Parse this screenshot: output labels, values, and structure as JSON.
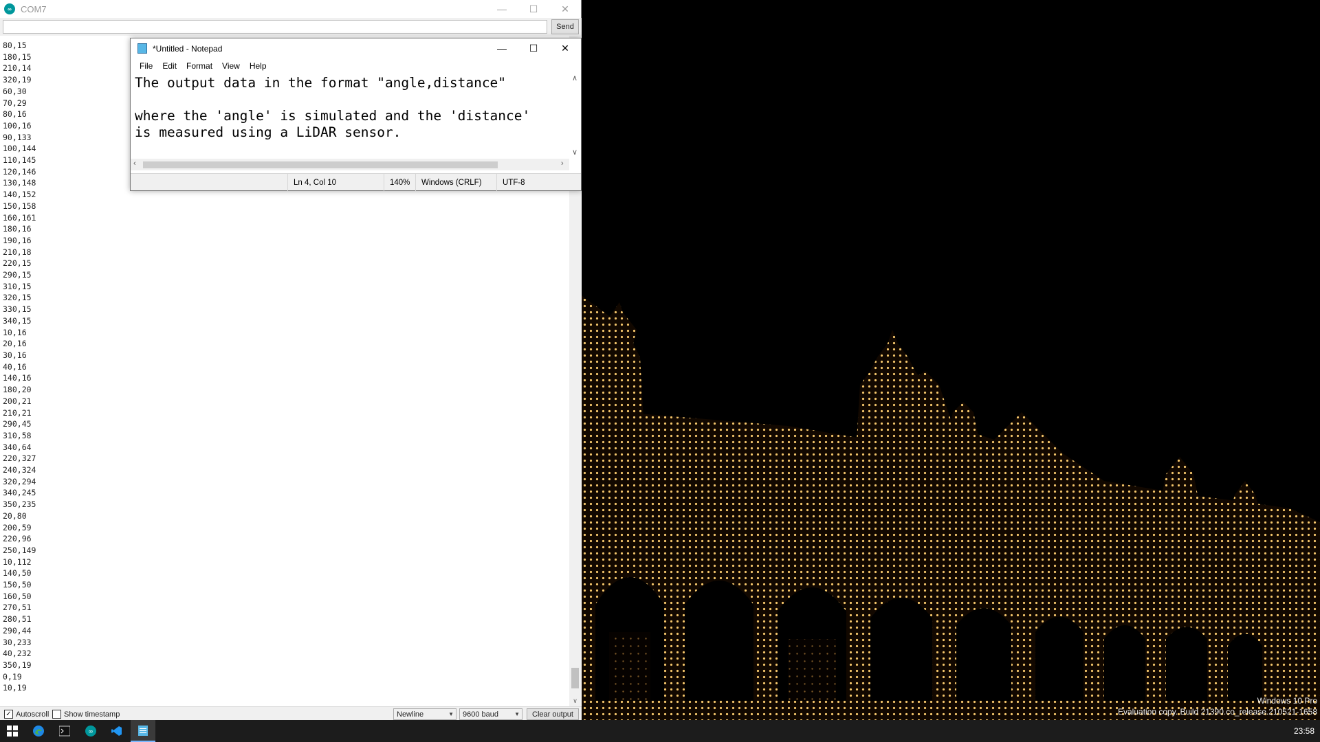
{
  "serial_monitor": {
    "title": "COM7",
    "send_label": "Send",
    "input_value": "",
    "output_lines": [
      "80,15",
      "180,15",
      "210,14",
      "320,19",
      "60,30",
      "70,29",
      "80,16",
      "100,16",
      "90,133",
      "100,144",
      "110,145",
      "120,146",
      "130,148",
      "140,152",
      "150,158",
      "160,161",
      "180,16",
      "190,16",
      "210,18",
      "220,15",
      "290,15",
      "310,15",
      "320,15",
      "330,15",
      "340,15",
      "10,16",
      "20,16",
      "30,16",
      "40,16",
      "140,16",
      "180,20",
      "200,21",
      "210,21",
      "290,45",
      "310,58",
      "340,64",
      "220,327",
      "240,324",
      "320,294",
      "340,245",
      "350,235",
      "20,80",
      "200,59",
      "220,96",
      "250,149",
      "10,112",
      "140,50",
      "150,50",
      "160,50",
      "270,51",
      "280,51",
      "290,44",
      "30,233",
      "40,232",
      "350,19",
      "0,19",
      "10,19"
    ],
    "autoscroll_label": "Autoscroll",
    "autoscroll_checked": true,
    "timestamp_label": "Show timestamp",
    "timestamp_checked": false,
    "line_ending": "Newline",
    "baud_rate": "9600 baud",
    "clear_label": "Clear output"
  },
  "notepad": {
    "title": "*Untitled - Notepad",
    "menu": [
      "File",
      "Edit",
      "Format",
      "View",
      "Help"
    ],
    "content_lines": [
      "The output data in the format \"angle,distance\"",
      "",
      "where the 'angle' is simulated and the 'distance'",
      "is measured using a LiDAR sensor."
    ],
    "status": {
      "position": "Ln 4, Col 10",
      "zoom": "140%",
      "line_endings": "Windows (CRLF)",
      "encoding": "UTF-8"
    }
  },
  "desktop": {
    "watermark_line1": "Windows 10 Pro",
    "watermark_line2": "Evaluation copy. Build 21390.co_release.210521-1658"
  },
  "taskbar": {
    "icons": [
      "windows-start-icon",
      "edge-icon",
      "terminal-icon",
      "arduino-icon",
      "vscode-icon",
      "notepad-icon"
    ],
    "clock": "23:58"
  },
  "colors": {
    "arduino_teal": "#00979c",
    "taskbar": "#1c1c1c",
    "palace_lights": "#f3c56b"
  }
}
